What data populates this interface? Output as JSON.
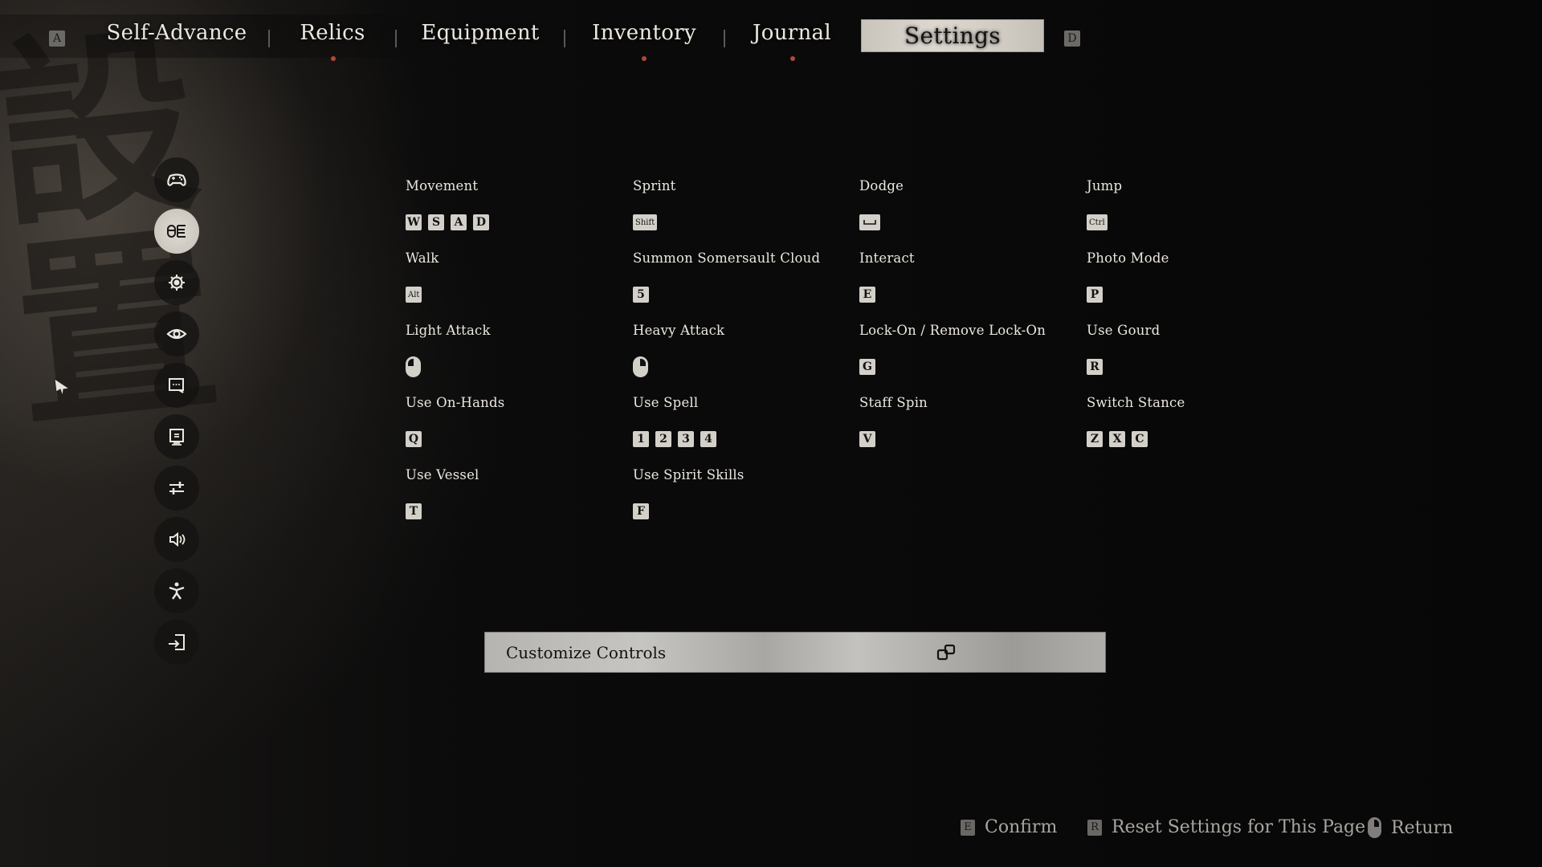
{
  "background": {
    "calligraphy": "設置"
  },
  "nav": {
    "prev_key": "A",
    "next_key": "D",
    "tabs": [
      {
        "label": "Self-Advance",
        "active": false,
        "notification": false
      },
      {
        "label": "Relics",
        "active": false,
        "notification": true
      },
      {
        "label": "Equipment",
        "active": false,
        "notification": false
      },
      {
        "label": "Inventory",
        "active": false,
        "notification": true
      },
      {
        "label": "Journal",
        "active": false,
        "notification": true
      },
      {
        "label": "Settings",
        "active": true,
        "notification": false
      }
    ],
    "notification_color": "#b0483c"
  },
  "sidebar": {
    "items": [
      {
        "icon": "gamepad-icon",
        "name": "controller-settings",
        "active": false
      },
      {
        "icon": "mouse-keyboard-icon",
        "name": "keyboard-mouse-settings",
        "active": true
      },
      {
        "icon": "gear-icon",
        "name": "game-settings",
        "active": false
      },
      {
        "icon": "eye-icon",
        "name": "camera-settings",
        "active": false
      },
      {
        "icon": "chat-bubble-icon",
        "name": "language-settings",
        "active": false
      },
      {
        "icon": "monitor-icon",
        "name": "display-settings",
        "active": false
      },
      {
        "icon": "sliders-icon",
        "name": "graphics-settings",
        "active": false
      },
      {
        "icon": "speaker-icon",
        "name": "audio-settings",
        "active": false
      },
      {
        "icon": "accessibility-icon",
        "name": "accessibility-settings",
        "active": false
      },
      {
        "icon": "exit-icon",
        "name": "exit-settings",
        "active": false
      }
    ]
  },
  "bindings": [
    {
      "label": "Movement",
      "keys": [
        "W",
        "S",
        "A",
        "D"
      ]
    },
    {
      "label": "Sprint",
      "keys": [
        "Shift"
      ]
    },
    {
      "label": "Dodge",
      "keys": [
        "Space"
      ]
    },
    {
      "label": "Jump",
      "keys": [
        "Ctrl"
      ]
    },
    {
      "label": "Walk",
      "keys": [
        "Alt"
      ]
    },
    {
      "label": "Summon Somersault Cloud",
      "keys": [
        "5"
      ]
    },
    {
      "label": "Interact",
      "keys": [
        "E"
      ]
    },
    {
      "label": "Photo Mode",
      "keys": [
        "P"
      ]
    },
    {
      "label": "Light Attack",
      "keys": [
        "Left Mouse Button"
      ]
    },
    {
      "label": "Heavy Attack",
      "keys": [
        "Right Mouse Button"
      ]
    },
    {
      "label": "Lock-On / Remove Lock-On",
      "keys": [
        "G"
      ]
    },
    {
      "label": "Use Gourd",
      "keys": [
        "R"
      ]
    },
    {
      "label": "Use On-Hands",
      "keys": [
        "Q"
      ]
    },
    {
      "label": "Use Spell",
      "keys": [
        "1",
        "2",
        "3",
        "4"
      ]
    },
    {
      "label": "Staff Spin",
      "keys": [
        "V"
      ]
    },
    {
      "label": "Switch Stance",
      "keys": [
        "Z",
        "X",
        "C"
      ]
    },
    {
      "label": "Use Vessel",
      "keys": [
        "T"
      ]
    },
    {
      "label": "Use Spirit Skills",
      "keys": [
        "F"
      ]
    }
  ],
  "customize": {
    "label": "Customize Controls",
    "icon": "external-window-icon"
  },
  "footer": {
    "confirm": {
      "key": "E",
      "label": "Confirm"
    },
    "reset": {
      "key": "R",
      "label": "Reset Settings for This Page"
    },
    "return": {
      "key": "Right Mouse Button",
      "label": "Return"
    }
  }
}
